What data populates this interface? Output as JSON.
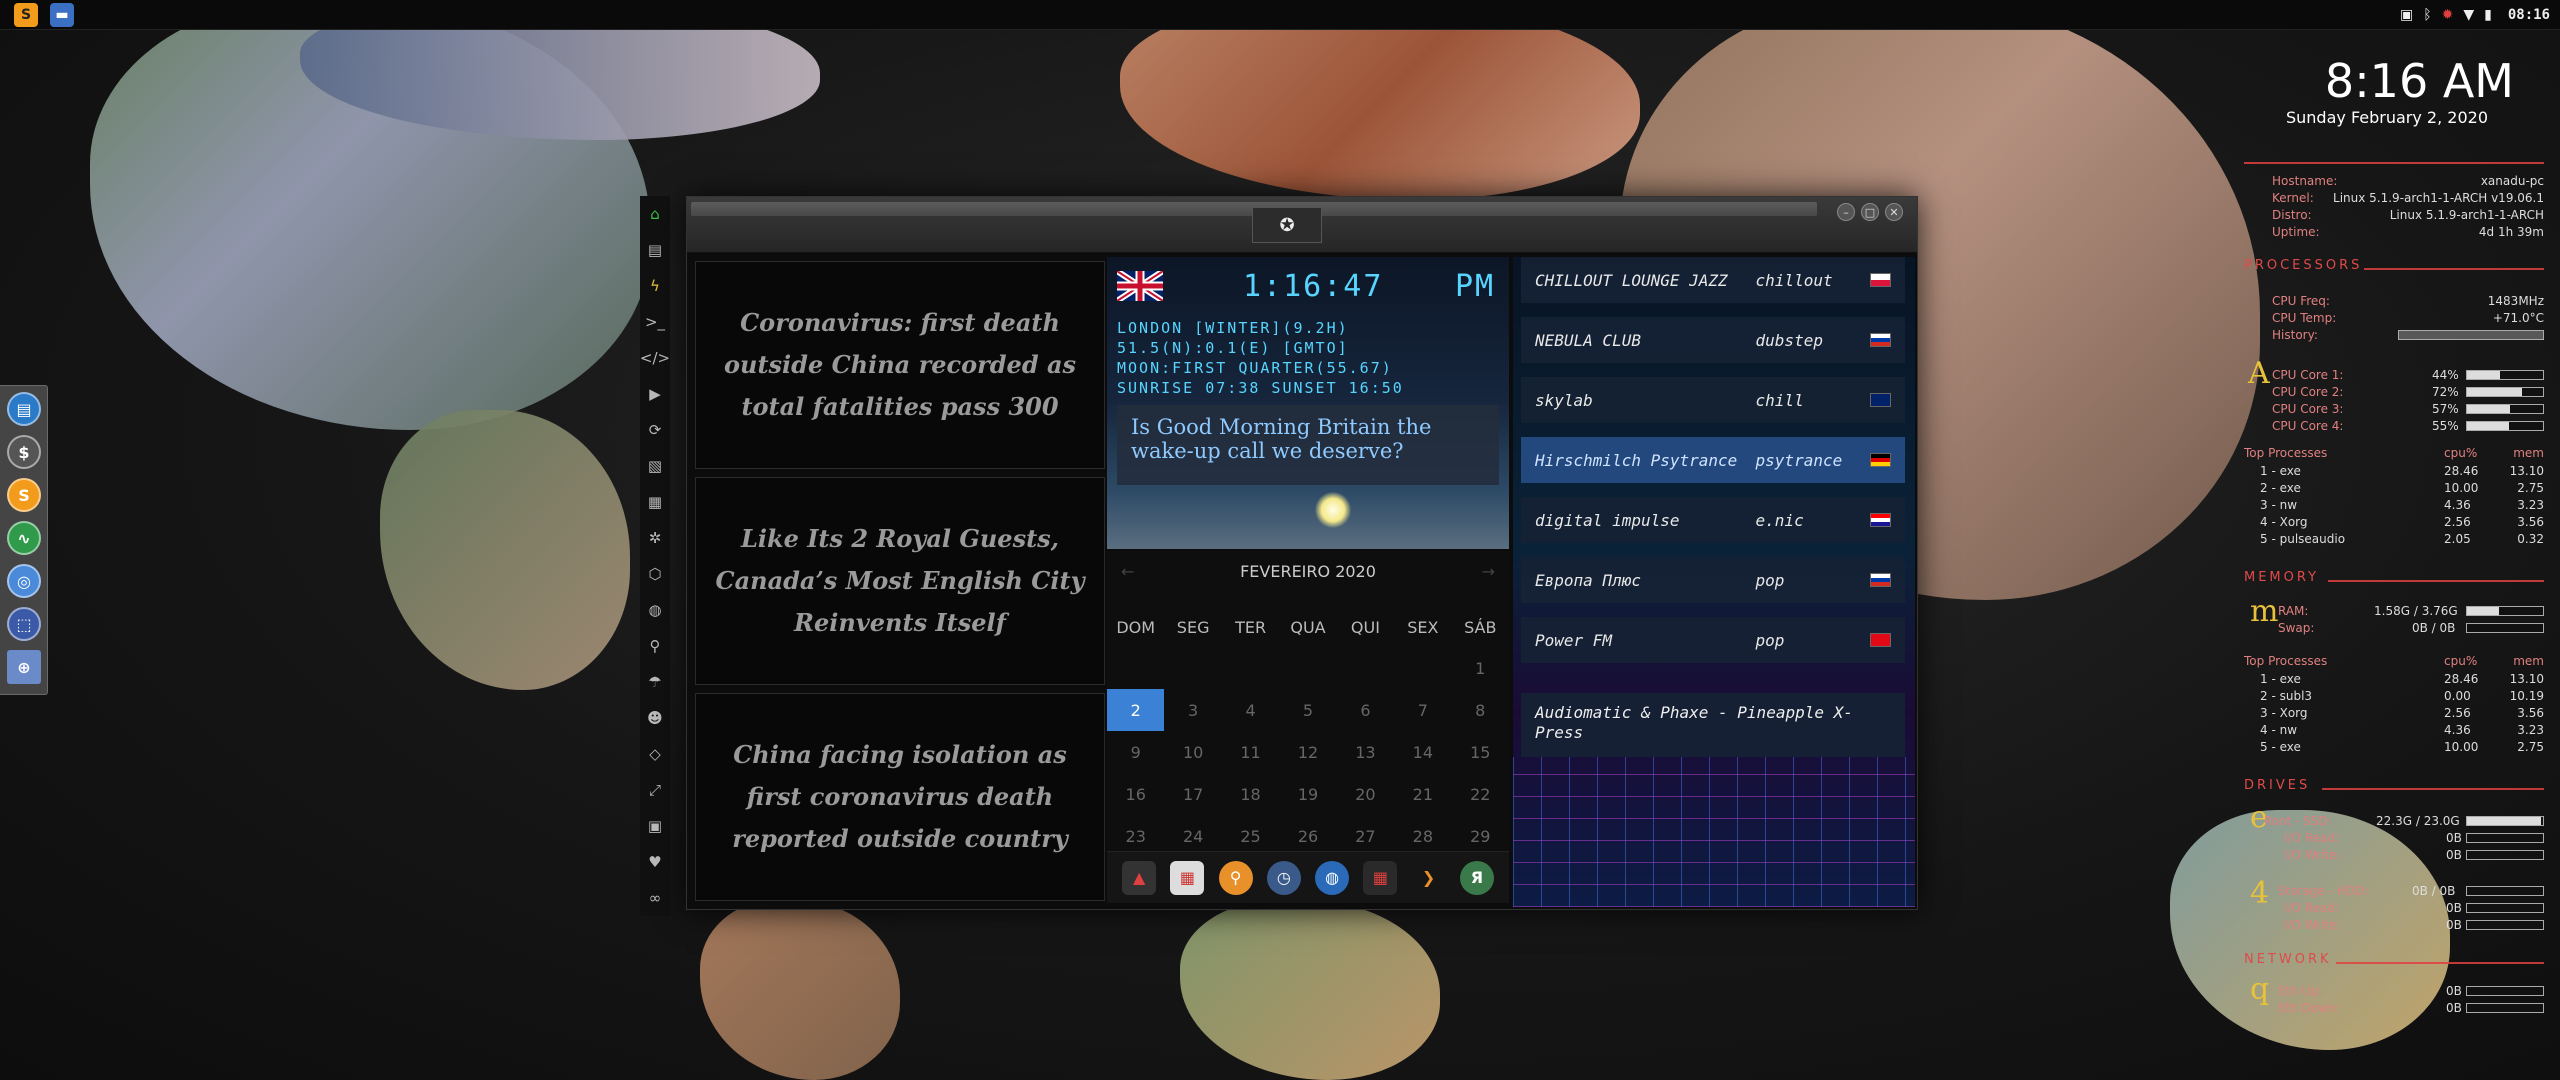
{
  "topbar": {
    "clock": "08:16",
    "tray_icons": [
      "image-icon",
      "bluetooth-icon",
      "alert-icon",
      "wifi-icon",
      "battery-icon"
    ]
  },
  "dock": {
    "items": [
      "files-icon",
      "terminal-icon",
      "sublime-icon",
      "activity-icon",
      "chrome-icon",
      "screenshot-icon",
      "globe-icon"
    ]
  },
  "desktop_clock": {
    "time": "8:16 AM",
    "date": "Sunday February  2, 2020"
  },
  "sidebar_rail": {
    "icons": [
      "home-icon",
      "document-icon",
      "bolt-icon",
      "terminal-icon",
      "code-icon",
      "play-icon",
      "sync-icon",
      "image-icon",
      "news-icon",
      "react-icon",
      "hexagon-icon",
      "globe-icon",
      "search-icon",
      "umbrella-icon",
      "user-icon",
      "tags-icon",
      "expand-icon",
      "youtube-icon",
      "heart-icon",
      "glasses-icon"
    ]
  },
  "news": {
    "items": [
      "Coronavirus: first death outside China recorded as total fatalities pass 300",
      "Like Its 2 Royal Guests, Canada’s Most English City Reinvents Itself",
      "China facing isolation as first coronavirus death reported outside country"
    ]
  },
  "world_clock": {
    "time": "1:16:47",
    "ampm": "PM",
    "lines": [
      "LONDON [WINTER](9.2H)",
      "51.5(N):0.1(E) [GMTO]",
      "MOON:FIRST QUARTER(55.67)",
      "SUNRISE  07:38 SUNSET  16:50"
    ],
    "headline": "Is Good Morning Britain the wake-up call we deserve?"
  },
  "calendar": {
    "month": "FEVEREIRO 2020",
    "weekdays": [
      "DOM",
      "SEG",
      "TER",
      "QUA",
      "QUI",
      "SEX",
      "SÁB"
    ],
    "days": [
      "",
      "",
      "",
      "",
      "",
      "",
      "1",
      "2",
      "3",
      "4",
      "5",
      "6",
      "7",
      "8",
      "9",
      "10",
      "11",
      "12",
      "13",
      "14",
      "15",
      "16",
      "17",
      "18",
      "19",
      "20",
      "21",
      "22",
      "23",
      "24",
      "25",
      "26",
      "27",
      "28",
      "29"
    ],
    "today": "2"
  },
  "app_tray": [
    "arch-icon",
    "calendar-icon",
    "search-icon",
    "clock-icon",
    "globe-icon",
    "calendar-active-icon",
    "arrow-icon",
    "yandex-icon"
  ],
  "radio": {
    "stations": [
      {
        "name": "CHILLOUT LOUNGE JAZZ",
        "genre": "chillout",
        "flag": "poland"
      },
      {
        "name": "NEBULA CLUB",
        "genre": "dubstep",
        "flag": "russia"
      },
      {
        "name": "skylab",
        "genre": "chill",
        "flag": "uk"
      },
      {
        "name": "Hirschmilch Psytrance",
        "genre": "psytrance",
        "flag": "germany"
      },
      {
        "name": "digital impulse",
        "genre": "e.nic",
        "flag": "croatia"
      },
      {
        "name": "Европа Плюс",
        "genre": "pop",
        "flag": "russia"
      },
      {
        "name": "Power FM",
        "genre": "pop",
        "flag": "turkey"
      }
    ],
    "now_playing": "Audiomatic & Phaxe - Pineapple X-Press"
  },
  "conky": {
    "system": [
      {
        "label": "Hostname:",
        "value": "xanadu-pc"
      },
      {
        "label": "Kernel:",
        "value": "Linux 5.1.9-arch1-1-ARCH v19.06.1"
      },
      {
        "label": "Distro:",
        "value": "Linux 5.1.9-arch1-1-ARCH"
      },
      {
        "label": "Uptime:",
        "value": "4d 1h 39m"
      }
    ],
    "processors_title": "PROCESSORS",
    "cpu_freq_label": "CPU Freq:",
    "cpu_freq": "1483MHz",
    "cpu_temp_label": "CPU Temp:",
    "cpu_temp": "+71.0°C",
    "history_label": "History:",
    "cpu_letter": "A",
    "cores": [
      {
        "label": "CPU Core 1:",
        "value": "44%",
        "fill": 0.44
      },
      {
        "label": "CPU Core 2:",
        "value": "72%",
        "fill": 0.72
      },
      {
        "label": "CPU Core 3:",
        "value": "57%",
        "fill": 0.57
      },
      {
        "label": "CPU Core 4:",
        "value": "55%",
        "fill": 0.55
      }
    ],
    "top_processes_label": "Top Processes",
    "cpu_col": "cpu%",
    "mem_col": "mem",
    "cpu_procs": [
      {
        "n": "1 - exe",
        "cpu": "28.46",
        "mem": "13.10"
      },
      {
        "n": "2 - exe",
        "cpu": "10.00",
        "mem": "2.75"
      },
      {
        "n": "3 - nw",
        "cpu": "4.36",
        "mem": "3.23"
      },
      {
        "n": "4 - Xorg",
        "cpu": "2.56",
        "mem": "3.56"
      },
      {
        "n": "5 - pulseaudio",
        "cpu": "2.05",
        "mem": "0.32"
      }
    ],
    "memory_title": "MEMORY",
    "mem_letter": "m",
    "ram_label": "RAM:",
    "ram": "1.58G / 3.76G",
    "ram_fill": 0.42,
    "swap_label": "Swap:",
    "swap": "0B / 0B",
    "mem_procs": [
      {
        "n": "1 - exe",
        "cpu": "28.46",
        "mem": "13.10"
      },
      {
        "n": "2 - subl3",
        "cpu": "0.00",
        "mem": "10.19"
      },
      {
        "n": "3 - Xorg",
        "cpu": "2.56",
        "mem": "3.56"
      },
      {
        "n": "4 - nw",
        "cpu": "4.36",
        "mem": "3.23"
      },
      {
        "n": "5 - exe",
        "cpu": "10.00",
        "mem": "2.75"
      }
    ],
    "drives_title": "DRIVES",
    "drive_letter": "e",
    "root_label": "Root - SSD:",
    "root": "22.3G / 23.0G",
    "root_fill": 0.97,
    "io_read_label": "I/O Read:",
    "io_read": "0B",
    "io_write_label": "I/O Write:",
    "io_write": "0B",
    "storage_letter": "4",
    "storage_label": "Storage - HDD:",
    "storage": "0B / 0B",
    "io2_read": "0B",
    "io2_write": "0B",
    "network_title": "NETWORK",
    "net_letter": "q",
    "eth_up_label": "Eth Up:",
    "eth_up": "0B",
    "eth_down_label": "Eth Down:",
    "eth_down": "0B"
  }
}
